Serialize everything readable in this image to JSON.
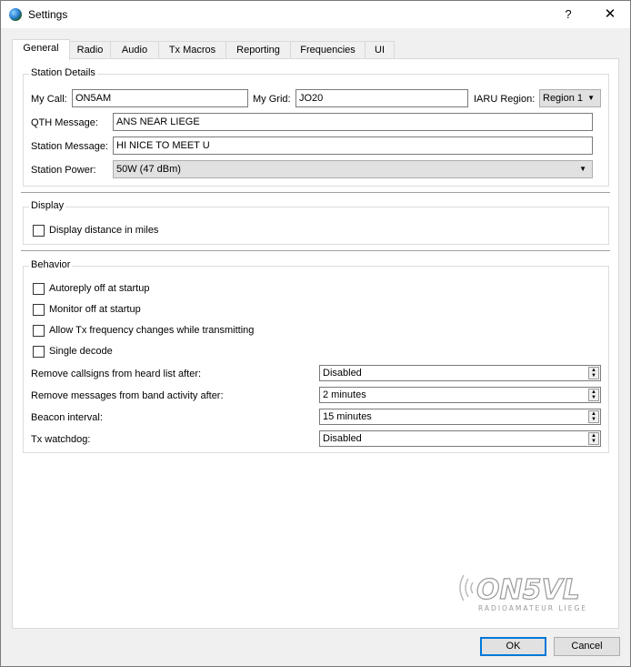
{
  "window": {
    "title": "Settings",
    "help_label": "?",
    "close_label": "✕"
  },
  "tabs": [
    "General",
    "Radio",
    "Audio",
    "Tx Macros",
    "Reporting",
    "Frequencies",
    "UI"
  ],
  "station": {
    "group_title": "Station Details",
    "my_call_label": "My Call:",
    "my_call_value": "ON5AM",
    "my_grid_label": "My Grid:",
    "my_grid_value": "JO20",
    "iaru_label": "IARU Region:",
    "iaru_value": "Region 1",
    "qth_label": "QTH Message:",
    "qth_value": "ANS NEAR LIEGE",
    "station_msg_label": "Station Message:",
    "station_msg_value": "HI NICE TO MEET U",
    "power_label": "Station Power:",
    "power_value": "50W (47 dBm)"
  },
  "display": {
    "group_title": "Display",
    "distance_miles_label": "Display distance in miles",
    "distance_miles_checked": false
  },
  "behavior": {
    "group_title": "Behavior",
    "checkboxes": [
      {
        "label": "Autoreply off at startup",
        "checked": false
      },
      {
        "label": "Monitor off at startup",
        "checked": false
      },
      {
        "label": "Allow Tx frequency changes while transmitting",
        "checked": false
      },
      {
        "label": "Single decode",
        "checked": false
      }
    ],
    "heard_label": "Remove callsigns from heard list after:",
    "heard_value": "Disabled",
    "band_label": "Remove messages from band activity after:",
    "band_value": "2 minutes",
    "beacon_label": "Beacon interval:",
    "beacon_value": "15 minutes",
    "watchdog_label": "Tx watchdog:",
    "watchdog_value": "Disabled"
  },
  "watermark": {
    "main": "ON5VL",
    "sub": "RADIOAMATEUR LIEGE"
  },
  "buttons": {
    "ok": "OK",
    "cancel": "Cancel"
  },
  "colors": {
    "accent": "#0078d7",
    "panel_bg": "#ffffff",
    "window_bg": "#f0f0f0"
  }
}
